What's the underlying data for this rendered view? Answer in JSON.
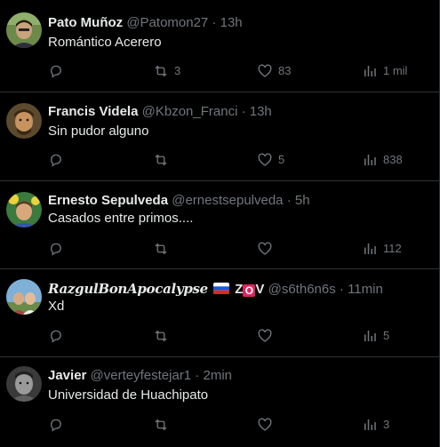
{
  "tweets": [
    {
      "name": "Pato Muñoz",
      "handle": "@Patomon27",
      "time": "13h",
      "text": "Romántico Acerero",
      "retweets": "3",
      "likes": "83",
      "views": "1 mil"
    },
    {
      "name": "Francis Videla",
      "handle": "@Kbzon_Franci",
      "time": "13h",
      "text": "Sin pudor alguno",
      "retweets": "",
      "likes": "5",
      "views": "838"
    },
    {
      "name": "Ernesto Sepulveda",
      "handle": "@ernestsepulveda",
      "time": "5h",
      "text": "Casados entre primos....",
      "retweets": "",
      "likes": "",
      "views": "112"
    },
    {
      "name": "RazgulBonApocalypse",
      "name_suffix_z": "Z",
      "name_suffix_o": "O",
      "name_suffix_v": "V",
      "handle": "@s6th6n6s",
      "time": "11min",
      "text": "Xd",
      "retweets": "",
      "likes": "",
      "views": "5"
    },
    {
      "name": "Javier",
      "handle": "@verteyfestejar1",
      "time": "2min",
      "text": "Universidad de Huachipato",
      "retweets": "",
      "likes": "",
      "views": "3"
    }
  ],
  "separator": "·",
  "colors": {
    "background": "#000000",
    "text": "#e7e9ea",
    "muted": "#71767b",
    "border": "#2f3336"
  },
  "icons": [
    "reply-icon",
    "retweet-icon",
    "like-icon",
    "views-icon"
  ]
}
